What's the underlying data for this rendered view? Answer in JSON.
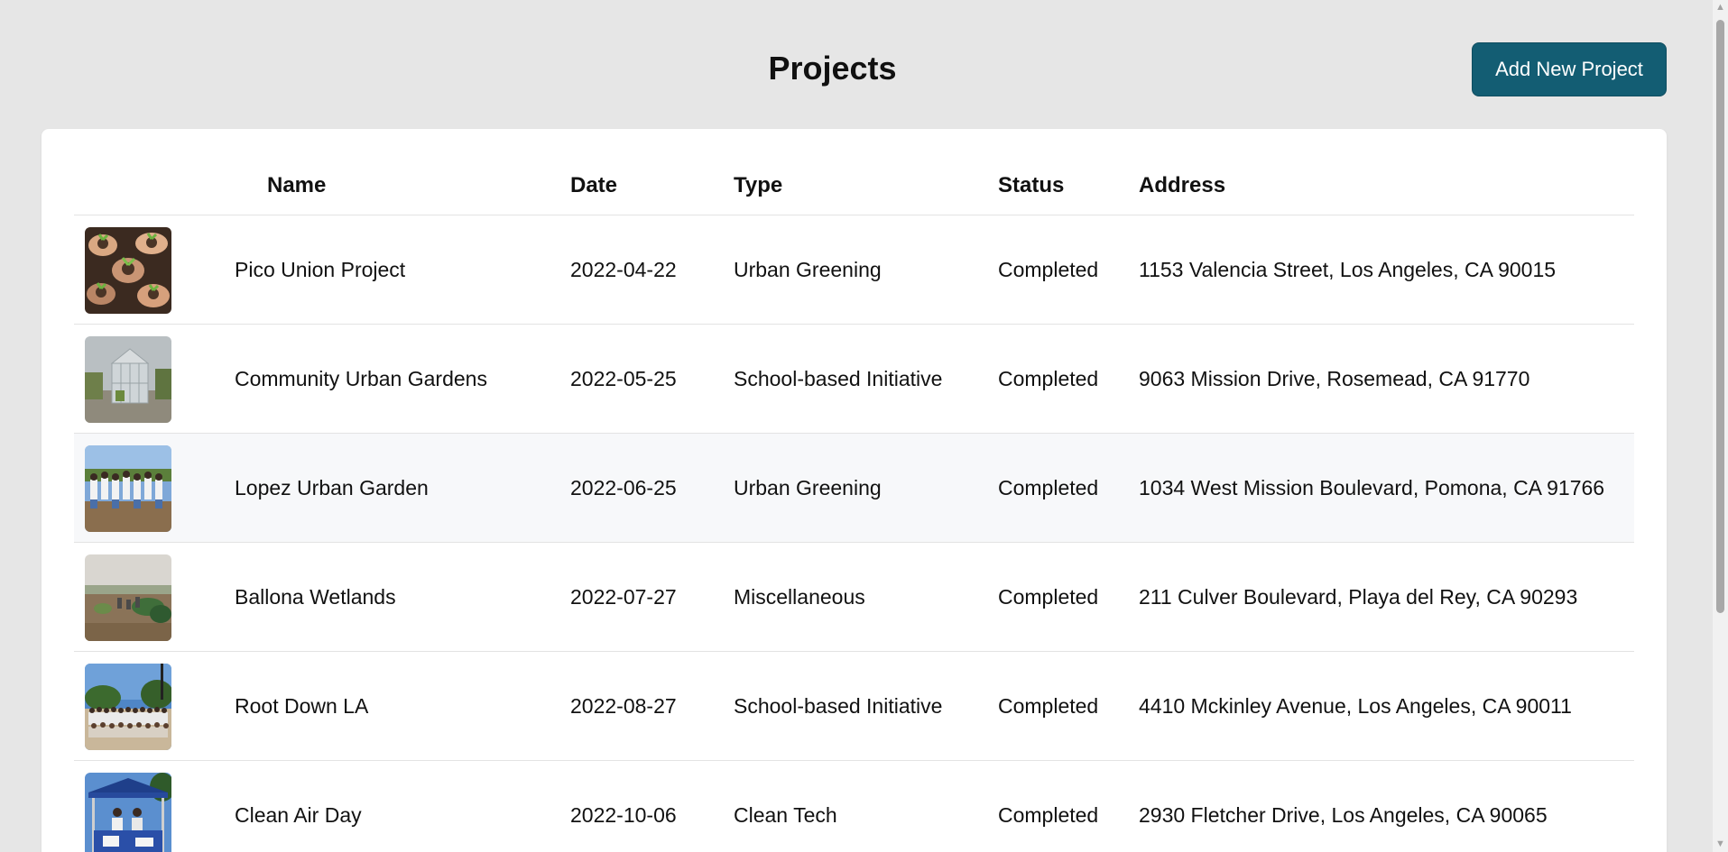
{
  "header": {
    "title": "Projects",
    "add_button_label": "Add New Project"
  },
  "table": {
    "columns": [
      "Name",
      "Date",
      "Type",
      "Status",
      "Address"
    ],
    "rows": [
      {
        "name": "Pico Union Project",
        "date": "2022-04-22",
        "type": "Urban Greening",
        "status": "Completed",
        "address": "1153 Valencia Street, Los Angeles, CA 90015",
        "thumbnail": "hands-holding-seedlings-photo"
      },
      {
        "name": "Community Urban Gardens",
        "date": "2022-05-25",
        "type": "School-based Initiative",
        "status": "Completed",
        "address": "9063 Mission Drive, Rosemead, CA 91770",
        "thumbnail": "greenhouse-photo"
      },
      {
        "name": "Lopez Urban Garden",
        "date": "2022-06-25",
        "type": "Urban Greening",
        "status": "Completed",
        "address": "1034 West Mission Boulevard, Pomona, CA 91766",
        "thumbnail": "group-volunteers-photo"
      },
      {
        "name": "Ballona Wetlands",
        "date": "2022-07-27",
        "type": "Miscellaneous",
        "status": "Completed",
        "address": "211 Culver Boulevard, Playa del Rey, CA 90293",
        "thumbnail": "wetlands-field-photo"
      },
      {
        "name": "Root Down LA",
        "date": "2022-08-27",
        "type": "School-based Initiative",
        "status": "Completed",
        "address": "4410 Mckinley Avenue, Los Angeles, CA 90011",
        "thumbnail": "large-group-photo"
      },
      {
        "name": "Clean Air Day",
        "date": "2022-10-06",
        "type": "Clean Tech",
        "status": "Completed",
        "address": "2930 Fletcher Drive, Los Angeles, CA 90065",
        "thumbnail": "canopy-tent-booth-photo"
      }
    ]
  },
  "colors": {
    "page_background": "#e6e6e6",
    "accent_button": "#135d73",
    "card_background": "#ffffff",
    "hover_row": "#f7f8fa"
  }
}
